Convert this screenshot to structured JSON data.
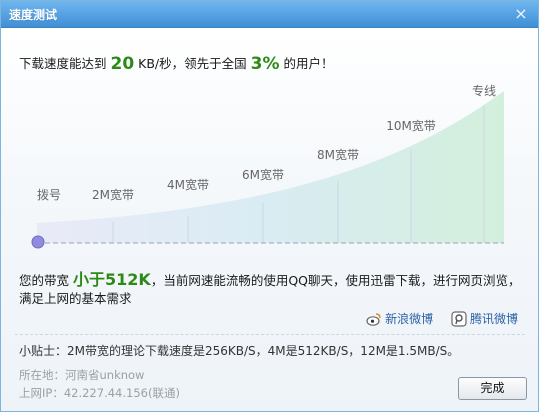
{
  "window": {
    "title": "速度测试",
    "close_glyph": "×"
  },
  "headline": {
    "prefix": "下载速度能达到",
    "speed": "20",
    "middle": "KB/秒，领先于全国",
    "percent": "3%",
    "suffix": "的用户！"
  },
  "chart": {
    "labels": [
      "拨号",
      "2M宽带",
      "4M宽带",
      "6M宽带",
      "8M宽带",
      "10M宽带",
      "专线"
    ],
    "current_position": "拨号",
    "colors": {
      "curve": "#c7e9d6",
      "marker": "#8f8ce0"
    }
  },
  "bandwidth": {
    "prefix": "您的带宽",
    "value": "小于512K",
    "rest": "，当前网速能流畅的使用QQ聊天，使用迅雷下载，进行网页浏览，满足上网的基本需求"
  },
  "share": {
    "sina": "新浪微博",
    "tencent": "腾讯微博"
  },
  "tip": "小贴士：2M带宽的理论下载速度是256KB/S，4M是512KB/S，12M是1.5MB/S。",
  "location": "所在地：河南省unknow",
  "ip": "上网IP：42.227.44.156(联通)",
  "done_label": "完成",
  "accent_color": "#2e8a17"
}
